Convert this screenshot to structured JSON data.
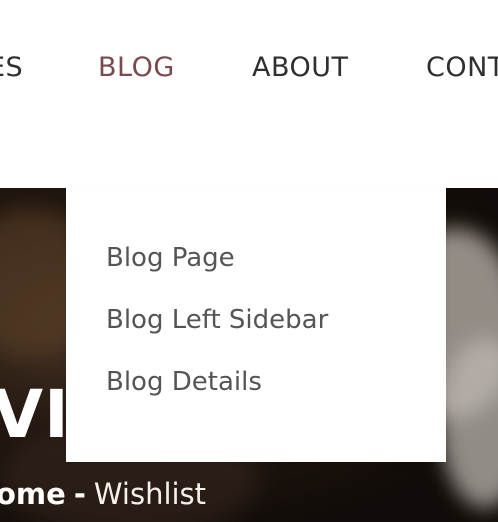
{
  "nav": {
    "items": [
      {
        "label": "ES"
      },
      {
        "label": "BLOG"
      },
      {
        "label": "ABOUT"
      },
      {
        "label": "CONT"
      }
    ]
  },
  "dropdown": {
    "items": [
      {
        "label": "Blog Page"
      },
      {
        "label": "Blog Left Sidebar"
      },
      {
        "label": "Blog Details"
      }
    ]
  },
  "hero": {
    "title": "VIS",
    "breadcrumb": {
      "home": "ome",
      "separator": "-",
      "current": "Wishlist"
    }
  },
  "colors": {
    "nav_text": "#2f2f2f",
    "nav_active": "#7a4a4f",
    "dropdown_text": "#555555",
    "hero_text": "#ffffff"
  }
}
